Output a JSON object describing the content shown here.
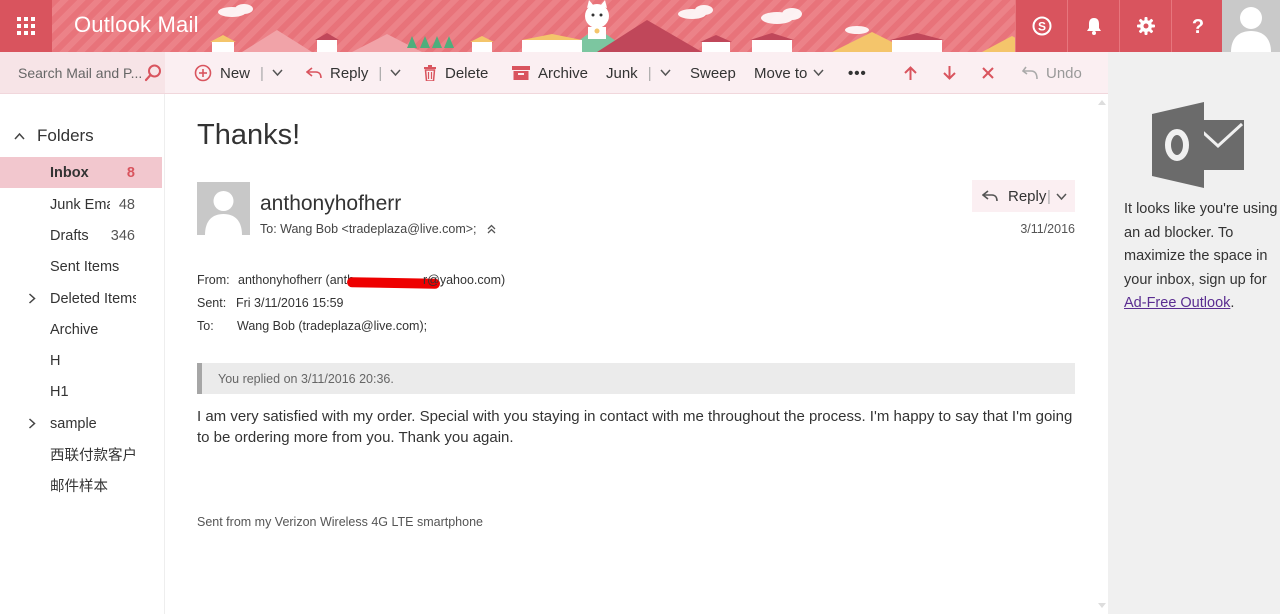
{
  "header": {
    "app_title": "Outlook Mail",
    "icons": [
      "app-launcher-icon",
      "skype-icon",
      "bell-icon",
      "gear-icon",
      "help-icon",
      "user-avatar-icon"
    ],
    "colors": {
      "brand": "#d9545e",
      "banner": "#e8737a"
    }
  },
  "search": {
    "placeholder": "Search Mail and P..."
  },
  "toolbar": {
    "new_label": "New",
    "reply_label": "Reply",
    "delete_label": "Delete",
    "archive_label": "Archive",
    "junk_label": "Junk",
    "sweep_label": "Sweep",
    "move_to_label": "Move to",
    "more_label": "•••",
    "undo_label": "Undo"
  },
  "sidebar": {
    "folders_label": "Folders",
    "items": [
      {
        "label": "Inbox",
        "count": "8"
      },
      {
        "label": "Junk Ema",
        "count": "48"
      },
      {
        "label": "Drafts",
        "count": "346"
      },
      {
        "label": "Sent Items",
        "count": ""
      },
      {
        "label": "Deleted Items",
        "count": ""
      },
      {
        "label": "Archive",
        "count": ""
      },
      {
        "label": "H",
        "count": ""
      },
      {
        "label": "H1",
        "count": ""
      },
      {
        "label": "sample",
        "count": ""
      },
      {
        "label": "西联付款客户",
        "count": ""
      },
      {
        "label": "邮件样本",
        "count": ""
      }
    ]
  },
  "message": {
    "subject": "Thanks!",
    "sender_name": "anthonyhofherr",
    "to_line": "To: Wang Bob <tradeplaza@live.com>;",
    "date": "3/11/2016",
    "reply_label": "Reply",
    "from_key": "From:",
    "from_value": "anthonyhofherr (anth",
    "from_value_tail": "r@yahoo.com)",
    "sent_key": "Sent:",
    "sent_value": "Fri 3/11/2016 15:59",
    "to_key": "To:",
    "to_value": "Wang Bob (tradeplaza@live.com);",
    "replied_notice": "You replied on 3/11/2016 20:36.",
    "body": "I am very satisfied with my order. Special with you staying in contact with me throughout the process. I'm happy to say that I'm going to be ordering more from you. Thank you again.",
    "signature": "Sent from my Verizon Wireless 4G LTE smartphone"
  },
  "ad": {
    "text": "It looks like you're using an ad blocker. To maximize the space in your inbox, sign up for ",
    "link": "Ad-Free Outlook",
    "suffix": "."
  }
}
